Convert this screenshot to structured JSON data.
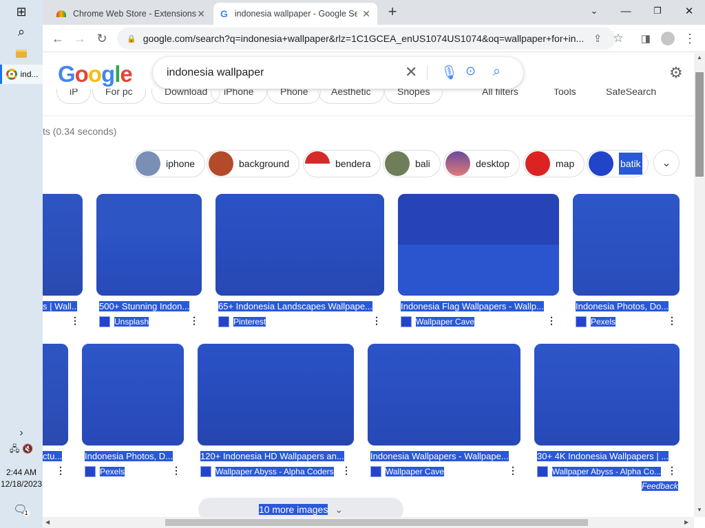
{
  "taskbar": {
    "active_app_label": "ind...",
    "time": "2:44 AM",
    "date": "12/18/2023",
    "notification_count": "1"
  },
  "tabs": [
    {
      "title": "Chrome Web Store - Extensions"
    },
    {
      "title": "indonesia wallpaper - Google Se"
    }
  ],
  "address": {
    "url": "google.com/search?q=indonesia+wallpaper&rlz=1C1GCEA_enUS1074US1074&oq=wallpaper+for+in..."
  },
  "search": {
    "query": "indonesia wallpaper"
  },
  "filters": [
    "iP",
    "For pc",
    "Download",
    "iPhone",
    "Phone",
    "Aesthetic",
    "Snopes",
    "All filters",
    "Tools",
    "SafeSearch"
  ],
  "result_stats": "ts (0.34 seconds)",
  "chips": [
    {
      "label": "iphone",
      "color": "#7a8fb5"
    },
    {
      "label": "background",
      "color": "#b34a2a"
    },
    {
      "label": "bendera",
      "color": "#d52a2a"
    },
    {
      "label": "bali",
      "color": "#6e7d5a"
    },
    {
      "label": "desktop",
      "color": "#a86aa8"
    },
    {
      "label": "map",
      "color": "#d22"
    },
    {
      "label": "batik",
      "color": "#2244c8"
    }
  ],
  "row1": [
    {
      "caption": "s | Wall...",
      "source": ""
    },
    {
      "caption": "500+ Stunning Indon...",
      "source": "Unsplash"
    },
    {
      "caption": "65+ Indonesia Landscapes Wallpape...",
      "source": "Pinterest"
    },
    {
      "caption": "Indonesia Flag Wallpapers - Wallp...",
      "source": "Wallpaper Cave"
    },
    {
      "caption": "Indonesia Photos, Do...",
      "source": "Pexels"
    }
  ],
  "row2": [
    {
      "caption": "ctu...",
      "source": ""
    },
    {
      "caption": "Indonesia Photos, D...",
      "source": "Pexels"
    },
    {
      "caption": "120+ Indonesia HD Wallpapers an...",
      "source": "Wallpaper Abyss - Alpha Coders"
    },
    {
      "caption": "Indonesia Wallpapers - Wallpape...",
      "source": "Wallpaper Cave"
    },
    {
      "caption": "30+ 4K Indonesia Wallpapers | ...",
      "source": "Wallpaper Abyss - Alpha Co..."
    }
  ],
  "feedback": "Feedback",
  "more_images": "10 more images",
  "colors": {
    "highlight": "#2a58d8",
    "tile": "#2a4fbf",
    "taskbar": "#dbe6f0"
  }
}
